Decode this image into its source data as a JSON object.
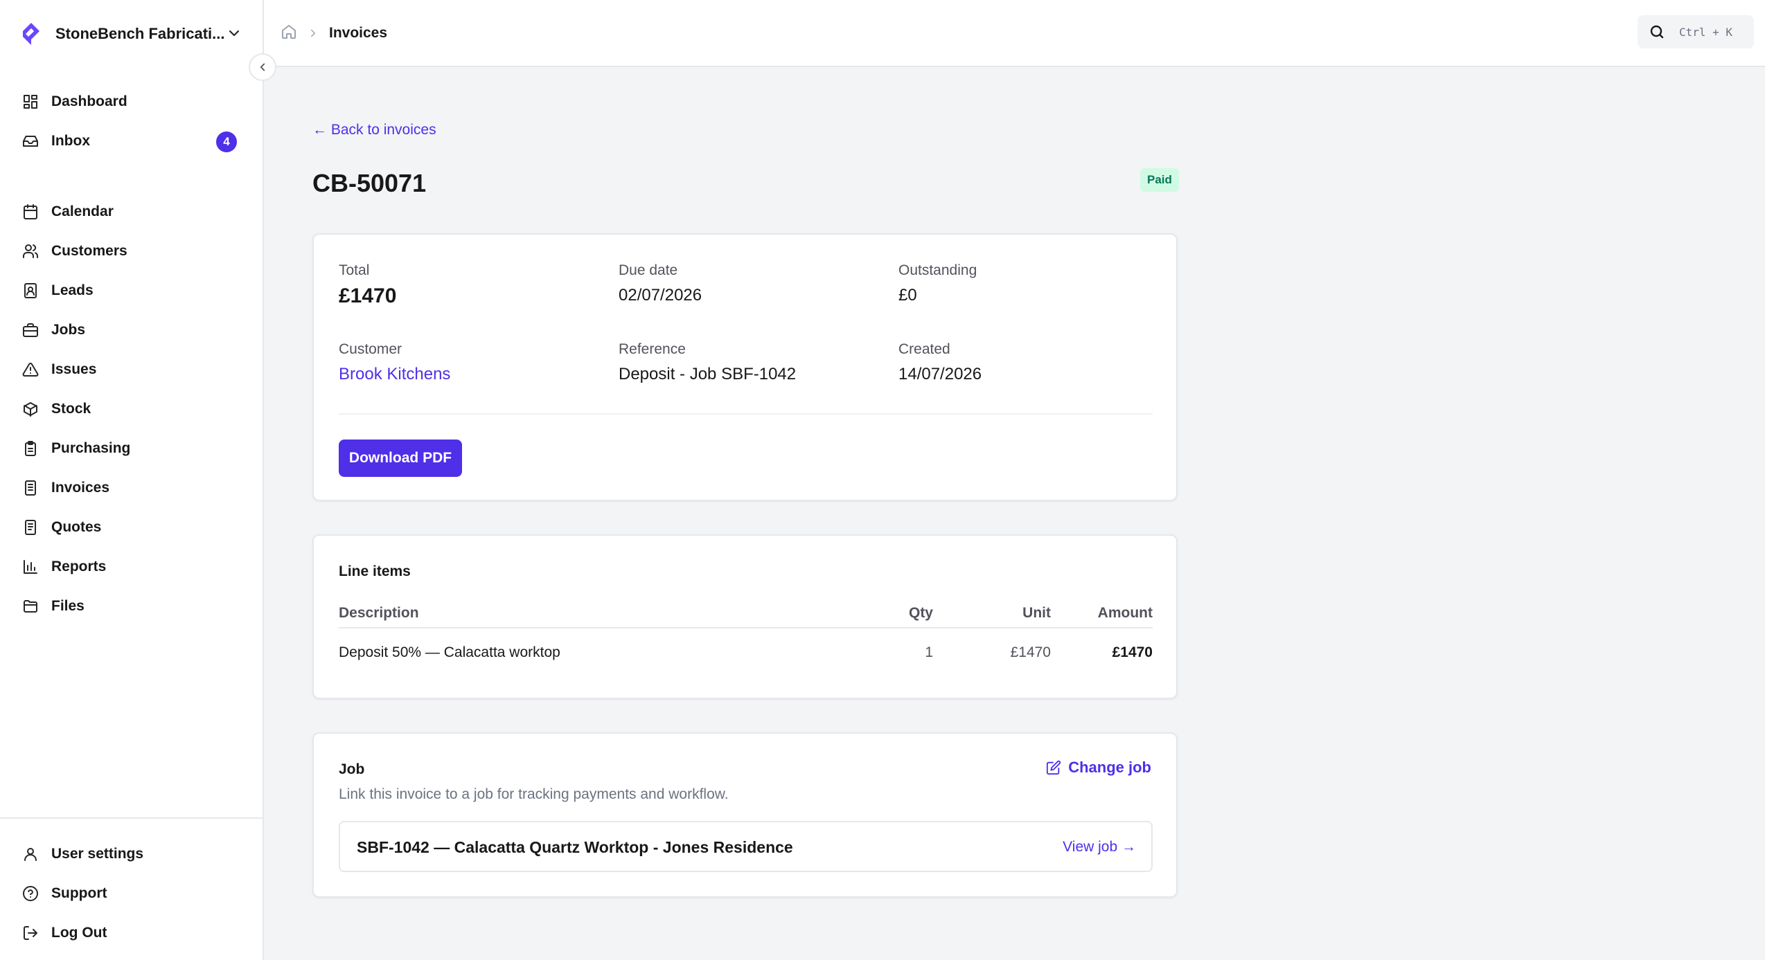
{
  "brand": {
    "name": "StoneBench Fabricati..."
  },
  "sidebar": {
    "items": [
      {
        "label": "Dashboard",
        "icon": "dashboard-icon"
      },
      {
        "label": "Inbox",
        "icon": "inbox-icon",
        "badge": "4"
      },
      {
        "label": "Calendar",
        "icon": "calendar-icon"
      },
      {
        "label": "Customers",
        "icon": "users-icon"
      },
      {
        "label": "Leads",
        "icon": "contact-icon"
      },
      {
        "label": "Jobs",
        "icon": "briefcase-icon"
      },
      {
        "label": "Issues",
        "icon": "warning-icon"
      },
      {
        "label": "Stock",
        "icon": "box-icon"
      },
      {
        "label": "Purchasing",
        "icon": "clipboard-icon"
      },
      {
        "label": "Invoices",
        "icon": "document-icon"
      },
      {
        "label": "Quotes",
        "icon": "document-icon"
      },
      {
        "label": "Reports",
        "icon": "bar-chart-icon"
      },
      {
        "label": "Files",
        "icon": "folder-icon"
      }
    ],
    "footer": [
      {
        "label": "User settings",
        "icon": "user-icon"
      },
      {
        "label": "Support",
        "icon": "help-icon"
      },
      {
        "label": "Log Out",
        "icon": "logout-icon"
      }
    ]
  },
  "topbar": {
    "breadcrumb_current": "Invoices",
    "search_shortcut": "Ctrl + K"
  },
  "invoice": {
    "back_label": "← Back to invoices",
    "number": "CB-50071",
    "status": "Paid",
    "total_label": "Total",
    "total_value": "£1470",
    "due_label": "Due date",
    "due_value": "02/07/2026",
    "outstanding_label": "Outstanding",
    "outstanding_value": "£0",
    "customer_label": "Customer",
    "customer_value": "Brook Kitchens",
    "reference_label": "Reference",
    "reference_value": "Deposit - Job SBF-1042",
    "created_label": "Created",
    "created_value": "14/07/2026",
    "download_label": "Download PDF"
  },
  "line_items": {
    "title": "Line items",
    "columns": {
      "description": "Description",
      "qty": "Qty",
      "unit": "Unit",
      "amount": "Amount"
    },
    "rows": [
      {
        "description": "Deposit 50% — Calacatta worktop",
        "qty": "1",
        "unit": "£1470",
        "amount": "£1470"
      }
    ]
  },
  "job": {
    "title": "Job",
    "subtitle": "Link this invoice to a job for tracking payments and workflow.",
    "change_label": "Change job",
    "name": "SBF-1042 — Calacatta Quartz Worktop - Jones Residence",
    "view_label": "View job →"
  },
  "colors": {
    "accent": "#4f2fe8",
    "paid_bg": "#d1fae5",
    "paid_text": "#047857"
  }
}
